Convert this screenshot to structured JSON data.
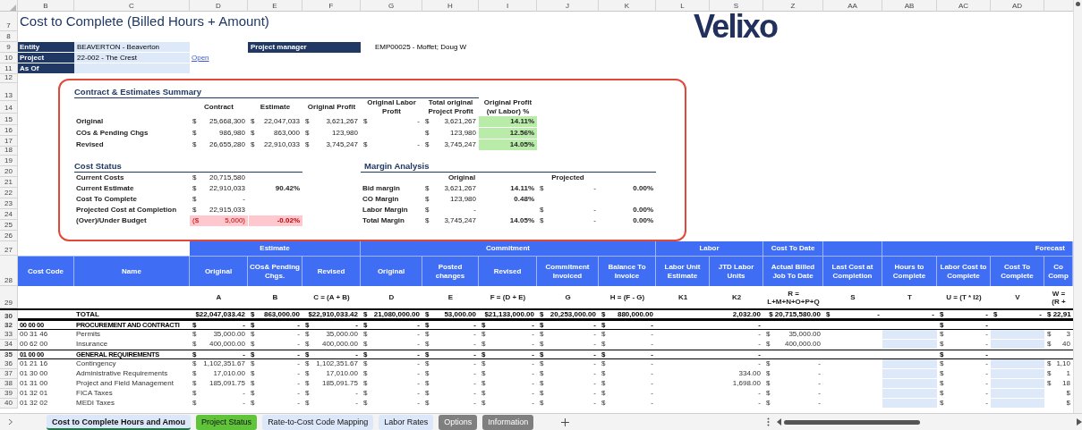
{
  "sheet_columns": [
    "B",
    "C",
    "D",
    "E",
    "F",
    "G",
    "H",
    "I",
    "J",
    "K",
    "L",
    "S",
    "Z",
    "AA",
    "AB",
    "AC",
    "AD"
  ],
  "top_row_numbers": [
    "7",
    "8",
    "9",
    "10",
    "11",
    "12",
    "13",
    "14",
    "15",
    "16",
    "17",
    "18",
    "19",
    "20",
    "21",
    "22",
    "23",
    "24",
    "25",
    "26"
  ],
  "title": "Cost to Complete (Billed Hours + Amount)",
  "logo": "Velixo",
  "fields": [
    {
      "label": "Entity",
      "value": "BEAVERTON - Beaverton"
    },
    {
      "label": "Project",
      "value": "22-002 - The Crest",
      "link": "Open"
    },
    {
      "label": "As Of"
    }
  ],
  "project_manager": {
    "label": "Project manager",
    "value": "EMP00025 - Moffet; Doug W"
  },
  "summary": {
    "title": "Contract & Estimates Summary",
    "columns": [
      "Contract",
      "Estimate",
      "Original Profit",
      "Original Labor Profit",
      "Total original Project Profit",
      "Original Profit (w/ Labor) %"
    ],
    "rows": [
      {
        "label": "Original",
        "cells": [
          [
            "$",
            "25,668,300"
          ],
          [
            "$",
            "22,047,033"
          ],
          [
            "$",
            "3,621,267"
          ],
          [
            "$",
            "-"
          ],
          [
            "$",
            "3,621,267"
          ]
        ],
        "percent": "14.11%"
      },
      {
        "label": "COs & Pending Chgs",
        "cells": [
          [
            "$",
            "986,980"
          ],
          [
            "$",
            "863,000"
          ],
          [
            "$",
            "123,980"
          ],
          null,
          [
            "$",
            "123,980"
          ]
        ],
        "percent": "12.56%"
      },
      {
        "label": "Revised",
        "cells": [
          [
            "$",
            "26,655,280"
          ],
          [
            "$",
            "22,910,033"
          ],
          [
            "$",
            "3,745,247"
          ],
          [
            "$",
            "-"
          ],
          [
            "$",
            "3,745,247"
          ]
        ],
        "percent": "14.05%"
      }
    ]
  },
  "cost_status": {
    "title": "Cost Status",
    "rows": [
      {
        "label": "Current Costs",
        "amount": [
          "$",
          "20,715,580"
        ],
        "negative": false
      },
      {
        "label": "Current Estimate",
        "amount": [
          "$",
          "22,910,033"
        ],
        "percent": "90.42%",
        "negative": false
      },
      {
        "label": "Cost To Complete",
        "amount": [
          "$",
          "-"
        ],
        "negative": false
      },
      {
        "label": "Projected Cost at Completion",
        "amount": [
          "$",
          "22,915,033"
        ],
        "negative": false
      },
      {
        "label": "(Over)/Under Budget",
        "amount": [
          "($",
          "5,000)"
        ],
        "percent": "-0.02%",
        "negative": true
      }
    ]
  },
  "margin_analysis": {
    "title": "Margin Analysis",
    "columns": [
      "Original",
      "Projected"
    ],
    "rows": [
      {
        "label": "Bid margin",
        "original": [
          "$",
          "3,621,267"
        ],
        "original_percent": "14.11%",
        "projected": [
          "$",
          "-"
        ],
        "projected_percent": "0.00%"
      },
      {
        "label": "CO Margin",
        "original": [
          "$",
          "123,980"
        ],
        "original_percent": "0.48%"
      },
      {
        "label": "Labor Margin",
        "original": [
          "$",
          "-"
        ],
        "projected": [
          "$",
          "-"
        ],
        "projected_percent": "0.00%"
      },
      {
        "label": "Total Margin",
        "original": [
          "$",
          "3,745,247"
        ],
        "original_percent": "14.05%",
        "projected": [
          "$",
          "-"
        ],
        "projected_percent": "0.00%"
      }
    ]
  },
  "table": {
    "header_row_numbers": [
      "27",
      "28",
      "29"
    ],
    "key_columns": [
      {
        "label": "Cost Code"
      },
      {
        "label": "Name"
      }
    ],
    "groups": [
      {
        "label": "Estimate",
        "columns": [
          {
            "label": "Original",
            "formula": "A"
          },
          {
            "label": "COs& Pending Chgs.",
            "formula": "B"
          },
          {
            "label": "Revised",
            "formula": "C = (A + B)"
          }
        ]
      },
      {
        "label": "Commitment",
        "columns": [
          {
            "label": "Original",
            "formula": "D"
          },
          {
            "label": "Posted changes",
            "formula": "E"
          },
          {
            "label": "Revised",
            "formula": "F = (D + E)"
          },
          {
            "label": "Commitment Invoiced",
            "formula": "G"
          },
          {
            "label": "Balance To Invoice",
            "formula": "H = (F - G)"
          }
        ]
      },
      {
        "label": "Labor",
        "columns": [
          {
            "label": "Labor Unit Estimate",
            "formula": "K1"
          },
          {
            "label": "JTD Labor Units",
            "formula": "K2"
          }
        ]
      },
      {
        "label": "Cost To Date",
        "columns": [
          {
            "label": "Actual Billed Job To Date",
            "formula": "R = L+M+N+O+P+Q"
          }
        ]
      },
      {
        "columns": [
          {
            "label": "Last Cost at Completion",
            "formula": "S"
          }
        ]
      },
      {
        "label": "Forecast",
        "columns": [
          {
            "label": "Hours to Complete",
            "formula": "T",
            "input": true
          },
          {
            "label": "Labor Cost to Complete",
            "formula": "U = (T * I2)"
          },
          {
            "label": "Cost To Complete",
            "formula": "V",
            "input": true
          },
          {
            "label": "Co Comp",
            "formula": "W = (R +"
          }
        ]
      }
    ],
    "rows": [
      {
        "row_number": "30",
        "kind": "total",
        "cells": [
          null,
          "TOTAL",
          "$22,047,033.42",
          [
            "$",
            "863,000.00"
          ],
          "$22,910,033.42",
          [
            "$",
            "21,080,000.00"
          ],
          [
            "$",
            "53,000.00"
          ],
          "$21,133,000.00",
          [
            "$",
            "20,253,000.00"
          ],
          [
            "$",
            "880,000.00"
          ],
          null,
          "2,032.00",
          "$ 20,715,580.00",
          [
            "$",
            "-"
          ],
          "-",
          [
            "$",
            "-"
          ],
          [
            "$",
            "-"
          ],
          "$ 22,91"
        ]
      },
      {
        "row_number": "32",
        "kind": "section",
        "cells": [
          "00 00 00",
          "PROCUREMENT AND CONTRACTI",
          [
            "$",
            "-"
          ],
          [
            "$",
            "-"
          ],
          [
            "$",
            "-"
          ],
          [
            "$",
            "-"
          ],
          [
            "$",
            "-"
          ],
          [
            "$",
            "-"
          ],
          [
            "$",
            "-"
          ],
          [
            "$",
            "-"
          ],
          null,
          "-",
          null,
          null,
          null,
          [
            "$",
            "-"
          ],
          null,
          null
        ]
      },
      {
        "row_number": "33",
        "kind": "item",
        "cells": [
          "00 31 46",
          "Permits",
          [
            "$",
            "35,000.00"
          ],
          [
            "$",
            "-"
          ],
          [
            "$",
            "35,000.00"
          ],
          [
            "$",
            "-"
          ],
          [
            "$",
            "-"
          ],
          [
            "$",
            "-"
          ],
          [
            "$",
            "-"
          ],
          [
            "$",
            "-"
          ],
          null,
          "-",
          [
            "$",
            "35,000.00"
          ],
          null,
          null,
          [
            "$",
            "-"
          ],
          null,
          [
            "$",
            "3"
          ]
        ]
      },
      {
        "row_number": "34",
        "kind": "item",
        "cells": [
          "00 62 00",
          "Insurance",
          [
            "$",
            "400,000.00"
          ],
          [
            "$",
            "-"
          ],
          [
            "$",
            "400,000.00"
          ],
          [
            "$",
            "-"
          ],
          [
            "$",
            "-"
          ],
          [
            "$",
            "-"
          ],
          [
            "$",
            "-"
          ],
          [
            "$",
            "-"
          ],
          null,
          "-",
          [
            "$",
            "400,000.00"
          ],
          null,
          null,
          [
            "$",
            "-"
          ],
          null,
          [
            "$",
            "40"
          ]
        ]
      },
      {
        "row_number": "35",
        "kind": "section",
        "cells": [
          "01 00 00",
          "GENERAL REQUIREMENTS",
          [
            "$",
            "-"
          ],
          [
            "$",
            "-"
          ],
          [
            "$",
            "-"
          ],
          [
            "$",
            "-"
          ],
          [
            "$",
            "-"
          ],
          [
            "$",
            "-"
          ],
          [
            "$",
            "-"
          ],
          [
            "$",
            "-"
          ],
          null,
          "-",
          null,
          null,
          null,
          [
            "$",
            "-"
          ],
          null,
          null
        ]
      },
      {
        "row_number": "36",
        "kind": "item",
        "cells": [
          "01 21 16",
          "Contingency",
          [
            "$",
            "1,102,351.67"
          ],
          [
            "$",
            "-"
          ],
          [
            "$",
            "1,102,351.67"
          ],
          [
            "$",
            "-"
          ],
          [
            "$",
            "-"
          ],
          [
            "$",
            "-"
          ],
          [
            "$",
            "-"
          ],
          [
            "$",
            "-"
          ],
          null,
          "-",
          [
            "$",
            "-"
          ],
          null,
          null,
          [
            "$",
            "-"
          ],
          null,
          [
            "$",
            "1,10"
          ]
        ]
      },
      {
        "row_number": "37",
        "kind": "item",
        "cells": [
          "01 30 00",
          "Administrative Requirements",
          [
            "$",
            "17,010.00"
          ],
          [
            "$",
            "-"
          ],
          [
            "$",
            "17,010.00"
          ],
          [
            "$",
            "-"
          ],
          [
            "$",
            "-"
          ],
          [
            "$",
            "-"
          ],
          [
            "$",
            "-"
          ],
          [
            "$",
            "-"
          ],
          null,
          "334.00",
          [
            "$",
            "-"
          ],
          null,
          null,
          [
            "$",
            "-"
          ],
          null,
          [
            "$",
            "1"
          ]
        ]
      },
      {
        "row_number": "38",
        "kind": "item",
        "cells": [
          "01 31 00",
          "Project and Field Management",
          [
            "$",
            "185,091.75"
          ],
          [
            "$",
            "-"
          ],
          [
            "$",
            "185,091.75"
          ],
          [
            "$",
            "-"
          ],
          [
            "$",
            "-"
          ],
          [
            "$",
            "-"
          ],
          [
            "$",
            "-"
          ],
          [
            "$",
            "-"
          ],
          null,
          "1,698.00",
          [
            "$",
            "-"
          ],
          null,
          null,
          [
            "$",
            "-"
          ],
          null,
          [
            "$",
            "18"
          ]
        ]
      },
      {
        "row_number": "39",
        "kind": "item",
        "cells": [
          "01 32 01",
          "FICA Taxes",
          [
            "$",
            "-"
          ],
          [
            "$",
            "-"
          ],
          [
            "$",
            "-"
          ],
          [
            "$",
            "-"
          ],
          [
            "$",
            "-"
          ],
          [
            "$",
            "-"
          ],
          [
            "$",
            "-"
          ],
          [
            "$",
            "-"
          ],
          null,
          "-",
          [
            "$",
            "-"
          ],
          null,
          null,
          [
            "$",
            "-"
          ],
          null,
          "$"
        ]
      },
      {
        "row_number": "40",
        "kind": "item",
        "cells": [
          "01 32 02",
          "MEDI Taxes",
          [
            "$",
            "-"
          ],
          [
            "$",
            "-"
          ],
          [
            "$",
            "-"
          ],
          [
            "$",
            "-"
          ],
          [
            "$",
            "-"
          ],
          [
            "$",
            "-"
          ],
          [
            "$",
            "-"
          ],
          [
            "$",
            "-"
          ],
          null,
          "-",
          [
            "$",
            "-"
          ],
          null,
          null,
          [
            "$",
            "-"
          ],
          null,
          "$"
        ]
      }
    ]
  },
  "sheet_tabs": [
    {
      "label": "Cost to Complete Hours and Amou",
      "selected": true,
      "color": "#dce8fa"
    },
    {
      "label": "Project Status",
      "selected": false,
      "color": "#5fc43a"
    },
    {
      "label": "Rate-to-Cost Code Mapping",
      "selected": false,
      "color": "#dce8fa"
    },
    {
      "label": "Labor Rates",
      "selected": false,
      "color": "#dce8fa"
    },
    {
      "label": "Options",
      "selected": false,
      "color": "#7f7f7f"
    },
    {
      "label": "Information",
      "selected": false,
      "color": "#7f7f7f"
    }
  ]
}
